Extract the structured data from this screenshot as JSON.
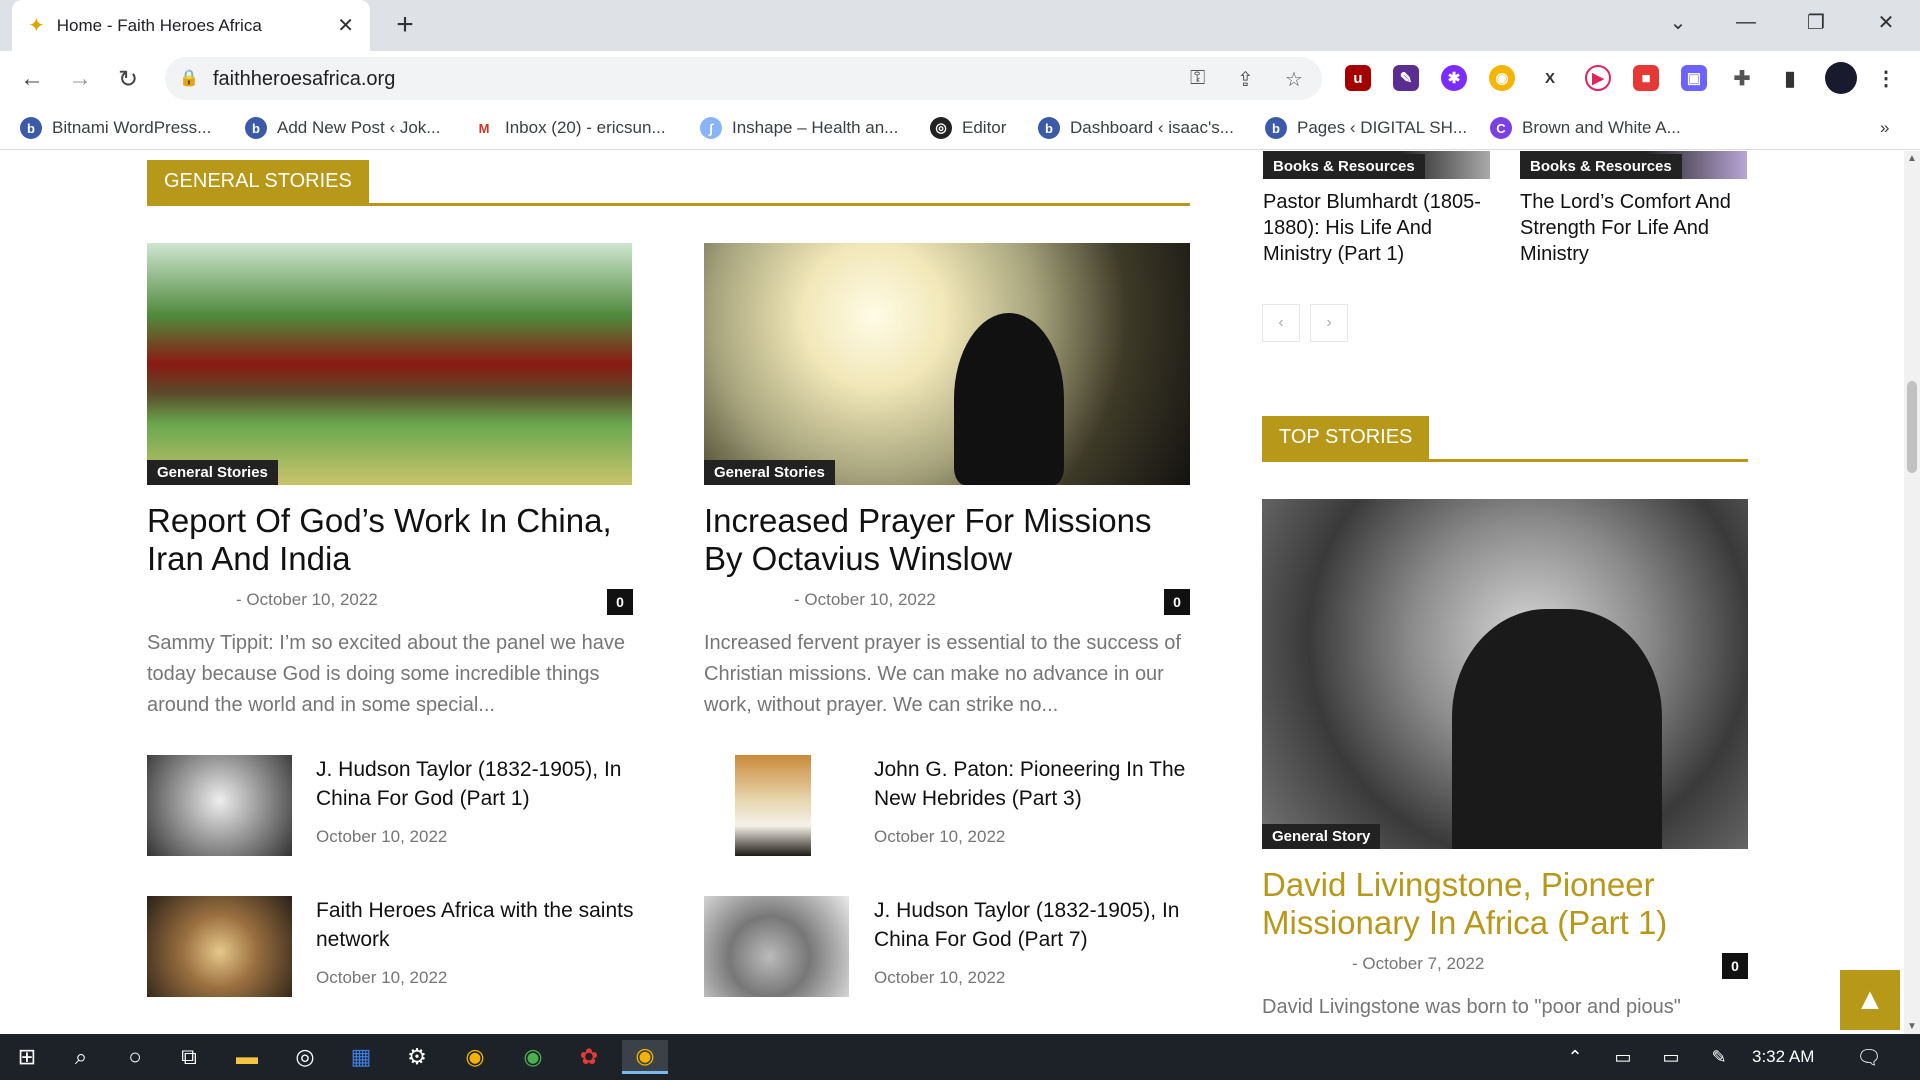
{
  "browser": {
    "tab_title": "Home - Faith Heroes Africa",
    "url": "faithheroesafrica.org",
    "bookmarks": [
      "Bitnami WordPress...",
      "Add New Post ‹ Jok...",
      "Inbox (20) - ericsun...",
      "Inshape – Health an...",
      "Editor",
      "Dashboard ‹ isaac's...",
      "Pages ‹ DIGITAL SH...",
      "Brown and White A..."
    ],
    "bookmarks_overflow": "»"
  },
  "general_stories": {
    "heading": "GENERAL STORIES",
    "featured": [
      {
        "category": "General Stories",
        "title": "Report Of God’s Work In China, Iran And India",
        "date": "October 10, 2022",
        "comments": "0",
        "excerpt": "Sammy Tippit: I’m so excited about the panel we have today because God is doing some incredible things around the world and in some special..."
      },
      {
        "category": "General Stories",
        "title": "Increased Prayer For Missions By Octavius Winslow",
        "date": "October 10, 2022",
        "comments": "0",
        "excerpt": "Increased fervent prayer is essential to the success of Christian missions. We can make no advance in our work, without prayer. We can strike no..."
      }
    ],
    "small_left": [
      {
        "title": "J. Hudson Taylor (1832-1905), In China For God (Part 1)",
        "date": "October 10, 2022"
      },
      {
        "title": "Faith Heroes Africa with the saints network",
        "date": "October 10, 2022"
      }
    ],
    "small_right": [
      {
        "title": "John G. Paton: Pioneering In The New Hebrides (Part 3)",
        "date": "October 10, 2022"
      },
      {
        "title": "J. Hudson Taylor (1832-1905), In China For God (Part 7)",
        "date": "October 10, 2022"
      }
    ]
  },
  "sidebar": {
    "carousel": [
      {
        "category": "Books & Resources",
        "title": "Pastor Blumhardt (1805-1880): His Life And Ministry (Part 1)"
      },
      {
        "category": "Books & Resources",
        "title": "The Lord’s Comfort And Strength For Life And Ministry"
      }
    ],
    "prev": "‹",
    "next": "›",
    "top_stories_heading": "TOP STORIES",
    "top_story": {
      "category": "General Story",
      "title": "David Livingstone, Pioneer Missionary In Africa (Part 1)",
      "date": "October 7, 2022",
      "comments": "0",
      "excerpt": "David Livingstone was born to \"poor and pious\""
    }
  },
  "taskbar": {
    "time": "3:32 AM"
  },
  "colors": {
    "accent": "#b89819",
    "title_link": "#b89819"
  }
}
